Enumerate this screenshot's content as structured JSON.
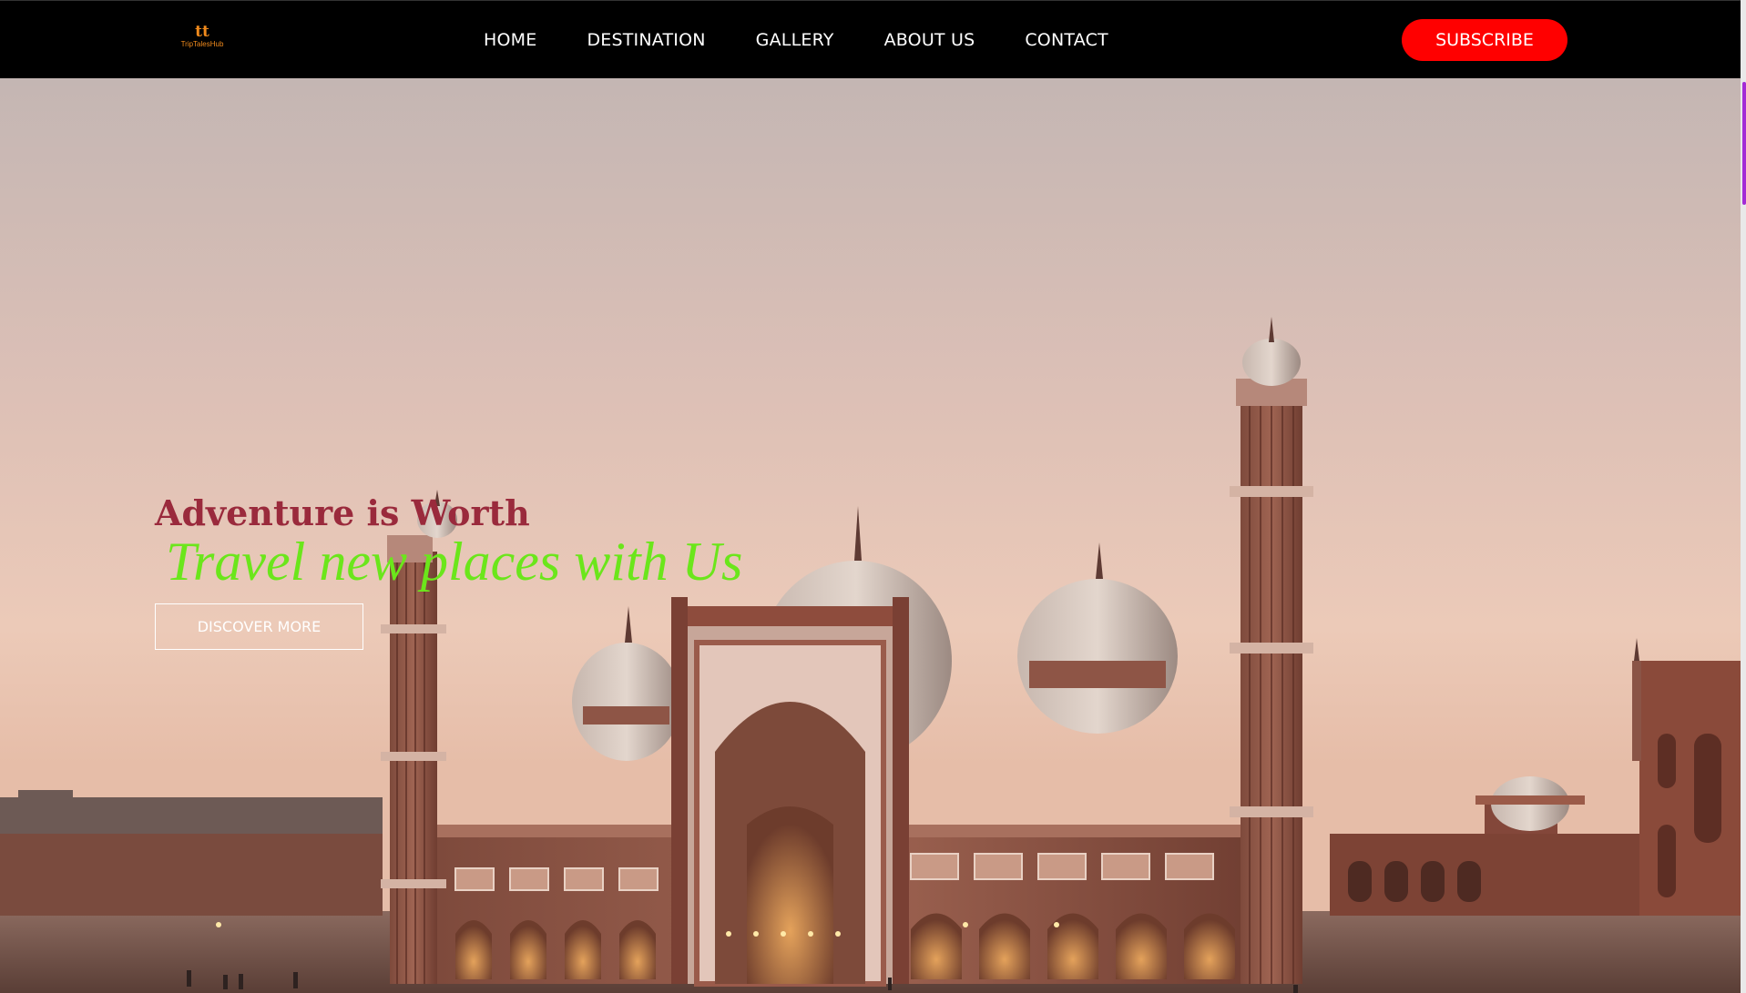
{
  "brand": {
    "logo_mark": "tt",
    "logo_text": "TripTalesHub"
  },
  "nav": {
    "items": [
      {
        "label": "HOME"
      },
      {
        "label": "DESTINATION"
      },
      {
        "label": "GALLERY"
      },
      {
        "label": "ABOUT US"
      },
      {
        "label": "CONTACT"
      }
    ],
    "subscribe_label": "SUBSCRIBE"
  },
  "hero": {
    "title": "Adventure is Worth",
    "subtitle": "Travel new places with Us",
    "cta_label": "DISCOVER MORE",
    "image_subject": "Mosque with domes and minarets at dusk"
  },
  "colors": {
    "navbar_bg": "#000000",
    "subscribe_bg": "#ff0000",
    "logo": "#f08a1c",
    "hero_title": "#9a2a3c",
    "hero_subtitle": "#6be61b",
    "scroll_thumb": "#a32bd6"
  }
}
